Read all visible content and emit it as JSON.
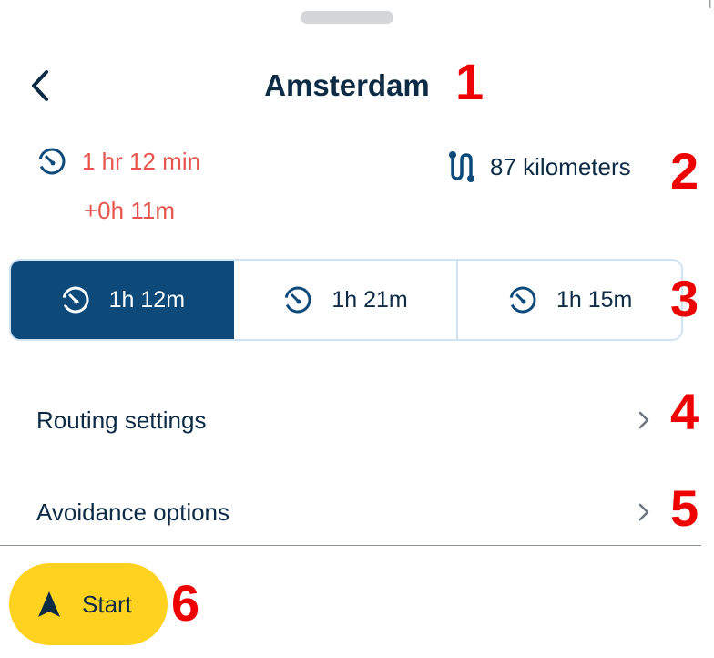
{
  "header": {
    "title": "Amsterdam",
    "back_icon": "chevron-left-icon",
    "corner_glyph": "ا"
  },
  "summary": {
    "eta": "1 hr 12 min",
    "delay": "+0h 11m",
    "distance": "87 kilometers",
    "eta_icon": "timer-icon",
    "distance_icon": "route-icon"
  },
  "routes": [
    {
      "label": "1h 12m",
      "selected": true,
      "icon": "timer-icon"
    },
    {
      "label": "1h 21m",
      "selected": false,
      "icon": "timer-icon"
    },
    {
      "label": "1h 15m",
      "selected": false,
      "icon": "timer-icon"
    }
  ],
  "menu": {
    "routing_settings": "Routing settings",
    "avoidance_options": "Avoidance options"
  },
  "start_button": {
    "label": "Start",
    "icon": "navigation-arrow-icon"
  },
  "annotations": [
    "1",
    "2",
    "3",
    "4",
    "5",
    "6"
  ],
  "colors": {
    "primary": "#0d4a7a",
    "text": "#0d2b45",
    "delay": "#e8554e",
    "start": "#ffd21f",
    "annotation": "#ee0000"
  }
}
